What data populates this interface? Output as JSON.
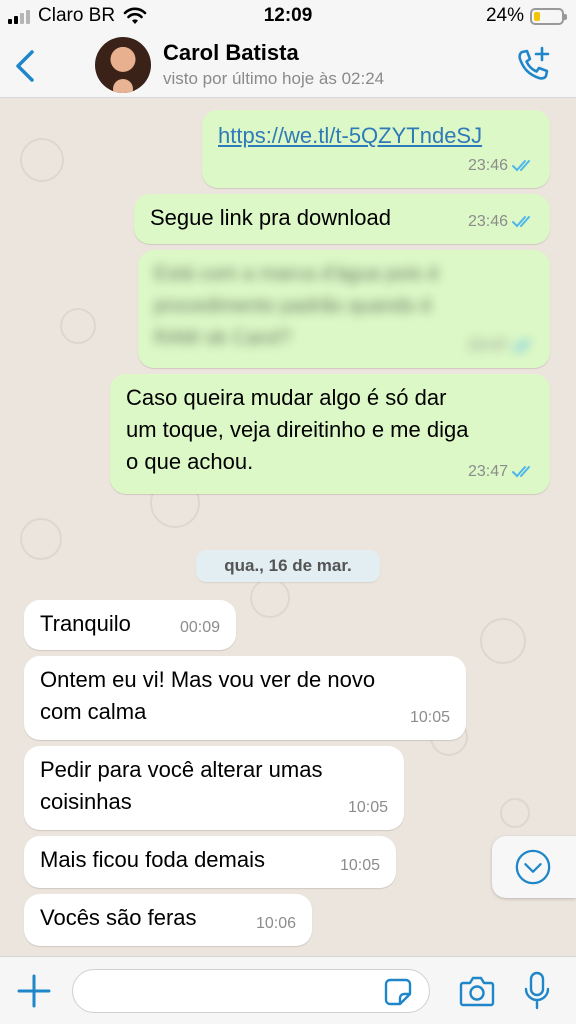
{
  "status_bar": {
    "carrier": "Claro BR",
    "time": "12:09",
    "battery_percent": "24%",
    "battery_level": 0.24,
    "battery_color": "#f5c400"
  },
  "header": {
    "back_icon": "chevron-left-icon",
    "contact_name": "Carol Batista",
    "last_seen": "visto por último hoje às 02:24",
    "call_icon": "add-call-icon",
    "accent_color": "#1f87c9"
  },
  "messages_before": [
    {
      "text": "https://we.tl/t-5QZYTndeSJ",
      "time": "23:46",
      "direction": "outgoing",
      "is_link": true
    },
    {
      "text": "Segue link pra download",
      "time": "23:46",
      "direction": "outgoing"
    },
    {
      "text_lines": [
        "Está com a marca d'água pois é",
        "procedimento padrão quando é",
        "RAW ok Carol?"
      ],
      "time": "23:47",
      "direction": "outgoing",
      "blurred": true
    },
    {
      "text_lines": [
        "Caso queira mudar algo é só dar",
        "um toque, veja direitinho e me diga",
        "o que achou."
      ],
      "time": "23:47",
      "direction": "outgoing"
    }
  ],
  "date_separator": "qua., 16 de mar.",
  "messages_after": [
    {
      "text": "Tranquilo",
      "time": "00:09",
      "direction": "incoming"
    },
    {
      "text_lines": [
        "Ontem eu vi! Mas vou ver de novo",
        "com calma"
      ],
      "time": "10:05",
      "direction": "incoming"
    },
    {
      "text_lines": [
        "Pedir para você alterar umas",
        "coisinhas"
      ],
      "time": "10:05",
      "direction": "incoming"
    },
    {
      "text": "Mais ficou foda demais",
      "time": "10:05",
      "direction": "incoming"
    },
    {
      "text": "Vocês são feras",
      "time": "10:06",
      "direction": "incoming"
    }
  ],
  "colors": {
    "outgoing_bubble": "#dcf8c6",
    "incoming_bubble": "#ffffff",
    "chat_background": "#ece5dd",
    "read_ticks": "#4fb6ec"
  },
  "scroll_button_icon": "chevron-down-circle-icon",
  "composer": {
    "input_value": "",
    "plus_icon": "plus-icon",
    "sticker_icon": "sticker-icon",
    "camera_icon": "camera-icon",
    "mic_icon": "microphone-icon"
  }
}
